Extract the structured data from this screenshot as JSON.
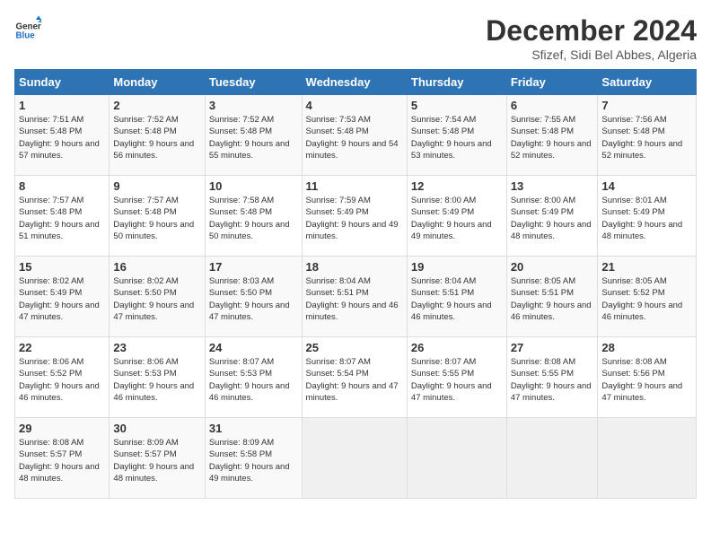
{
  "header": {
    "logo_line1": "General",
    "logo_line2": "Blue",
    "month": "December 2024",
    "location": "Sfizef, Sidi Bel Abbes, Algeria"
  },
  "weekdays": [
    "Sunday",
    "Monday",
    "Tuesday",
    "Wednesday",
    "Thursday",
    "Friday",
    "Saturday"
  ],
  "weeks": [
    [
      {
        "day": "1",
        "rise": "7:51 AM",
        "set": "5:48 PM",
        "daylight": "9 hours and 57 minutes."
      },
      {
        "day": "2",
        "rise": "7:52 AM",
        "set": "5:48 PM",
        "daylight": "9 hours and 56 minutes."
      },
      {
        "day": "3",
        "rise": "7:52 AM",
        "set": "5:48 PM",
        "daylight": "9 hours and 55 minutes."
      },
      {
        "day": "4",
        "rise": "7:53 AM",
        "set": "5:48 PM",
        "daylight": "9 hours and 54 minutes."
      },
      {
        "day": "5",
        "rise": "7:54 AM",
        "set": "5:48 PM",
        "daylight": "9 hours and 53 minutes."
      },
      {
        "day": "6",
        "rise": "7:55 AM",
        "set": "5:48 PM",
        "daylight": "9 hours and 52 minutes."
      },
      {
        "day": "7",
        "rise": "7:56 AM",
        "set": "5:48 PM",
        "daylight": "9 hours and 52 minutes."
      }
    ],
    [
      {
        "day": "8",
        "rise": "7:57 AM",
        "set": "5:48 PM",
        "daylight": "9 hours and 51 minutes."
      },
      {
        "day": "9",
        "rise": "7:57 AM",
        "set": "5:48 PM",
        "daylight": "9 hours and 50 minutes."
      },
      {
        "day": "10",
        "rise": "7:58 AM",
        "set": "5:48 PM",
        "daylight": "9 hours and 50 minutes."
      },
      {
        "day": "11",
        "rise": "7:59 AM",
        "set": "5:49 PM",
        "daylight": "9 hours and 49 minutes."
      },
      {
        "day": "12",
        "rise": "8:00 AM",
        "set": "5:49 PM",
        "daylight": "9 hours and 49 minutes."
      },
      {
        "day": "13",
        "rise": "8:00 AM",
        "set": "5:49 PM",
        "daylight": "9 hours and 48 minutes."
      },
      {
        "day": "14",
        "rise": "8:01 AM",
        "set": "5:49 PM",
        "daylight": "9 hours and 48 minutes."
      }
    ],
    [
      {
        "day": "15",
        "rise": "8:02 AM",
        "set": "5:49 PM",
        "daylight": "9 hours and 47 minutes."
      },
      {
        "day": "16",
        "rise": "8:02 AM",
        "set": "5:50 PM",
        "daylight": "9 hours and 47 minutes."
      },
      {
        "day": "17",
        "rise": "8:03 AM",
        "set": "5:50 PM",
        "daylight": "9 hours and 47 minutes."
      },
      {
        "day": "18",
        "rise": "8:04 AM",
        "set": "5:51 PM",
        "daylight": "9 hours and 46 minutes."
      },
      {
        "day": "19",
        "rise": "8:04 AM",
        "set": "5:51 PM",
        "daylight": "9 hours and 46 minutes."
      },
      {
        "day": "20",
        "rise": "8:05 AM",
        "set": "5:51 PM",
        "daylight": "9 hours and 46 minutes."
      },
      {
        "day": "21",
        "rise": "8:05 AM",
        "set": "5:52 PM",
        "daylight": "9 hours and 46 minutes."
      }
    ],
    [
      {
        "day": "22",
        "rise": "8:06 AM",
        "set": "5:52 PM",
        "daylight": "9 hours and 46 minutes."
      },
      {
        "day": "23",
        "rise": "8:06 AM",
        "set": "5:53 PM",
        "daylight": "9 hours and 46 minutes."
      },
      {
        "day": "24",
        "rise": "8:07 AM",
        "set": "5:53 PM",
        "daylight": "9 hours and 46 minutes."
      },
      {
        "day": "25",
        "rise": "8:07 AM",
        "set": "5:54 PM",
        "daylight": "9 hours and 47 minutes."
      },
      {
        "day": "26",
        "rise": "8:07 AM",
        "set": "5:55 PM",
        "daylight": "9 hours and 47 minutes."
      },
      {
        "day": "27",
        "rise": "8:08 AM",
        "set": "5:55 PM",
        "daylight": "9 hours and 47 minutes."
      },
      {
        "day": "28",
        "rise": "8:08 AM",
        "set": "5:56 PM",
        "daylight": "9 hours and 47 minutes."
      }
    ],
    [
      {
        "day": "29",
        "rise": "8:08 AM",
        "set": "5:57 PM",
        "daylight": "9 hours and 48 minutes."
      },
      {
        "day": "30",
        "rise": "8:09 AM",
        "set": "5:57 PM",
        "daylight": "9 hours and 48 minutes."
      },
      {
        "day": "31",
        "rise": "8:09 AM",
        "set": "5:58 PM",
        "daylight": "9 hours and 49 minutes."
      },
      null,
      null,
      null,
      null
    ]
  ]
}
